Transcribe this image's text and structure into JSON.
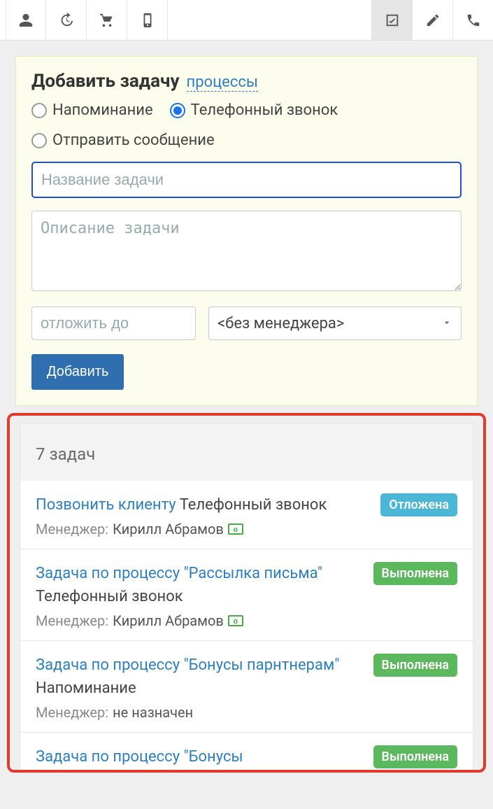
{
  "toolbar": {
    "left_icons": [
      "user-icon",
      "history-icon",
      "cart-icon",
      "mobile-icon"
    ],
    "right_icons": [
      "check-icon",
      "pencil-icon",
      "phone-icon"
    ],
    "active_right_index": 0
  },
  "form": {
    "title": "Добавить задачу",
    "processes_link": "процессы",
    "radio_options": [
      {
        "label": "Напоминание",
        "checked": false
      },
      {
        "label": "Телефонный звонок",
        "checked": true
      },
      {
        "label": "Отправить сообщение",
        "checked": false
      }
    ],
    "task_name_placeholder": "Название задачи",
    "task_name_value": "",
    "task_desc_placeholder": "Описание задачи",
    "task_desc_value": "",
    "postpone_placeholder": "отложить до",
    "postpone_value": "",
    "manager_select_value": "<без менеджера>",
    "submit_label": "Добавить"
  },
  "tasks": {
    "header": "7 задач",
    "manager_label": "Менеджер:",
    "items": [
      {
        "title": "Позвонить клиенту",
        "type": "Телефонный звонок",
        "manager": "Кирилл Абрамов",
        "has_money_icon": true,
        "status_label": "Отложена",
        "status_color": "blue"
      },
      {
        "title": "Задача по процессу \"Рассылка письма\"",
        "type": "Телефонный звонок",
        "manager": "Кирилл Абрамов",
        "has_money_icon": true,
        "status_label": "Выполнена",
        "status_color": "green"
      },
      {
        "title": "Задача по процессу \"Бонусы парнтнерам\"",
        "type": "Напоминание",
        "manager": "не назначен",
        "has_money_icon": false,
        "status_label": "Выполнена",
        "status_color": "green"
      },
      {
        "title": "Задача по процессу \"Бонусы",
        "type": "",
        "manager": "",
        "has_money_icon": false,
        "status_label": "Выполнена",
        "status_color": "green"
      }
    ]
  }
}
